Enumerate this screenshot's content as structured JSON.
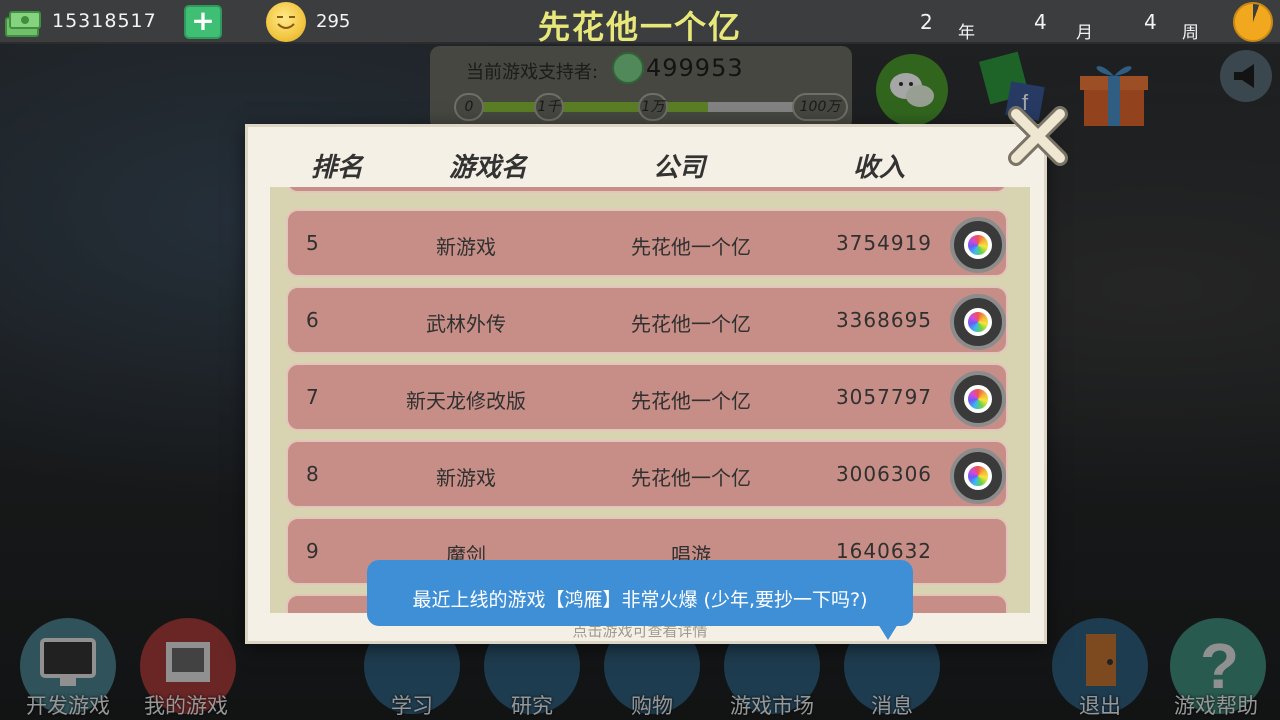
{
  "topbar": {
    "money": "15318517",
    "add_label": "+",
    "coins": "295",
    "company_name": "先花他一个亿",
    "year_num": "2",
    "year_unit": "年",
    "month_num": "4",
    "month_unit": "月",
    "week_num": "4",
    "week_unit": "周"
  },
  "supporters": {
    "label": "当前游戏支持者:",
    "value": "499953",
    "milestones": [
      "0",
      "1千",
      "1万",
      "100万"
    ],
    "progress": 0.68
  },
  "ranking": {
    "headers": {
      "rank": "排名",
      "game": "游戏名",
      "company": "公司",
      "income": "收入"
    },
    "rows": [
      {
        "rank": "5",
        "game": "新游戏",
        "company": "先花他一个亿",
        "income": "3754919",
        "has_detail": true
      },
      {
        "rank": "6",
        "game": "武林外传",
        "company": "先花他一个亿",
        "income": "3368695",
        "has_detail": true
      },
      {
        "rank": "7",
        "game": "新天龙修改版",
        "company": "先花他一个亿",
        "income": "3057797",
        "has_detail": true
      },
      {
        "rank": "8",
        "game": "新游戏",
        "company": "先花他一个亿",
        "income": "3006306",
        "has_detail": true
      },
      {
        "rank": "9",
        "game": "魔剑",
        "company": "唱游",
        "income": "1640632",
        "has_detail": false
      }
    ],
    "hint": "点击游戏可查看详情"
  },
  "toast": "最近上线的游戏【鸿雁】非常火爆 (少年,要抄一下吗?)",
  "bottom_nav": {
    "develop": "开发游戏",
    "my_games": "我的游戏",
    "learn": "学习",
    "research": "研究",
    "shop": "购物",
    "market": "游戏市场",
    "messages": "消息",
    "exit": "退出",
    "help": "游戏帮助"
  },
  "colors": {
    "row_bg": "#c68e86",
    "list_bg": "#d8d3b1",
    "modal_bg": "#f5f0e5",
    "toast_bg": "#3f8fd6",
    "title_color": "#e8e87a"
  }
}
